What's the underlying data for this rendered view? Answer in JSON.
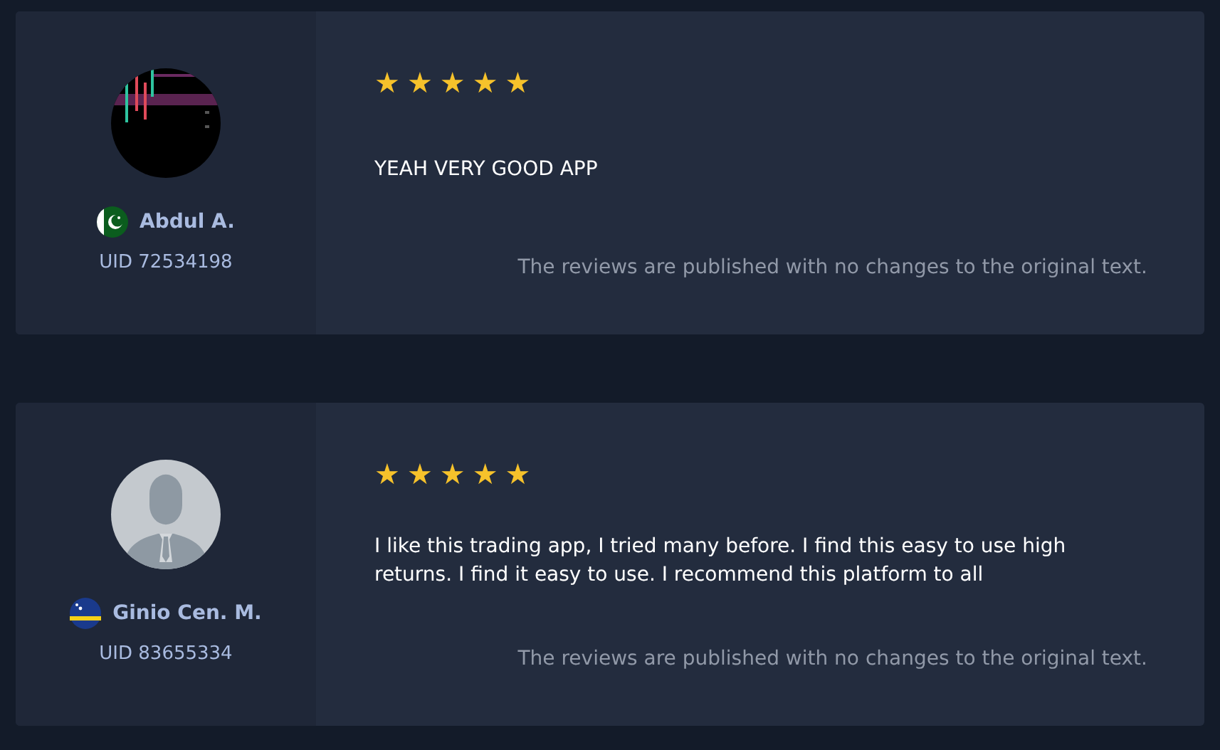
{
  "reviews": [
    {
      "name": "Abdul A.",
      "uid": "UID 72534198",
      "stars": 5,
      "text": "YEAH VERY GOOD APP",
      "note": "The reviews are published with no changes to the original text."
    },
    {
      "avatar": {
        "kind": "silhouette"
      },
      "name": "Ginio Cen. M.",
      "uid": "UID 83655334",
      "stars": 5,
      "text": "I like this trading app, I tried many before. I find this easy to use high returns. I find it easy to use. I recommend this platform to all",
      "note": "The reviews are published with no changes to the original text."
    }
  ]
}
